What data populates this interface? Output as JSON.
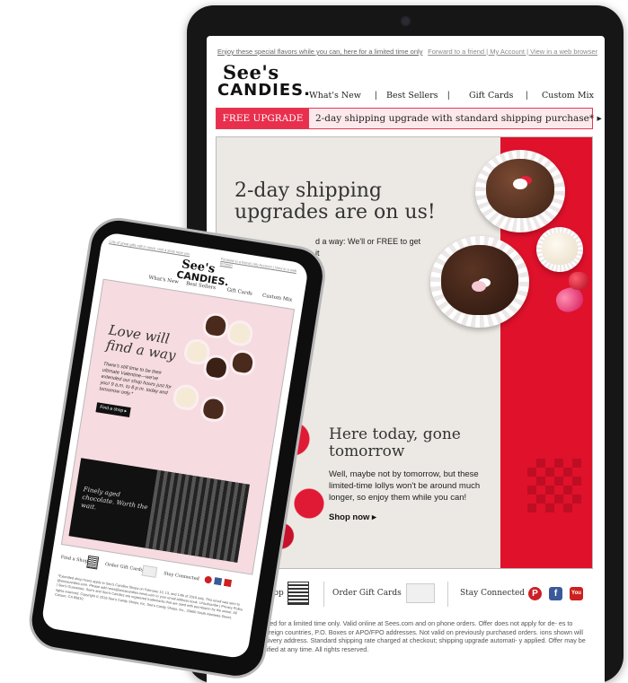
{
  "tablet": {
    "topbar_left": "Enjoy these special flavors while you can, here for a limited time only",
    "topbar_right": "Forward to a friend | My Account | View in a web browser",
    "logo_line1": "See's",
    "logo_line2": "CANDIES.",
    "nav": [
      "What's New",
      "Best Sellers",
      "Gift Cards",
      "Custom Mix"
    ],
    "promo_tag": "FREE UPGRADE",
    "promo_text": "2-day shipping upgrade with standard shipping purchase* ▸",
    "hero_title": "2-day shipping upgrades are on us!",
    "hero_body": "d a way: We'll or FREE to get it",
    "hero_h2": "Here today, gone tomorrow",
    "hero_p": "Well, maybe not by tomorrow, but these limited-time lollys won't be around much longer, so enjoy them while you can!",
    "hero_shop": "Shop now ▸",
    "footer": [
      "nd a Shop",
      "Order Gift Cards",
      "Stay Connected"
    ],
    "legal": "ping upgrade offered for a limited time only. Valid online at Sees.com and on phone orders. Offer does not apply for de- es to Alaska, Hawaii, foreign countries, P.O. Boxes or APO/FPO addresses. Not valid on previously purchased orders. ions shown will vary based on delivery address. Standard shipping rate charged at checkout; shipping upgrade automati- y applied. Offer may be cancelled or modified at any time. All rights reserved."
  },
  "phone": {
    "topbar_left": "Lots of great gifts still in stock, visit a shop near you",
    "topbar_right": "Forward to a friend | My Account | View in a web browser",
    "logo_line1": "See's",
    "logo_line2": "CANDIES.",
    "nav": [
      "What's New",
      "Best Sellers",
      "Gift Cards",
      "Custom Mix"
    ],
    "hero_title": "Love will find a way",
    "hero_body": "There's still time to be their ultimate Valentine—we've extended our shop hours just for you! 9 a.m. to 8 p.m. today and tomorrow only.*",
    "hero_btn": "Find a shop ▸",
    "box_text": "Finely aged chocolate. Worth the wait.",
    "footer": [
      "Find a Shop",
      "Order Gift Cards",
      "Stay Connected"
    ],
    "legal": "*Extended shop hours apply to See's Candies Shops on February 13, 13, and 14th of 2018 only. This email was sent to @seescandies.com. Please add news@seescandies-news.com to your email address book. Unsubscribe | Privacy Policy | See's Guarantee. See's and See's Candies are registered trademarks that are used with permission by the owner. All rights reserved. Copyright © 2018 See's Candy Shops, Inc. See's Candy Shops, Inc., 20600 South Alameda Street, Carson, CA 90810."
  },
  "colors": {
    "brand_red": "#e0112b",
    "promo_pink": "#fde9ec",
    "pinterest": "#cb2027",
    "facebook": "#3b5998",
    "youtube": "#cd201f"
  }
}
